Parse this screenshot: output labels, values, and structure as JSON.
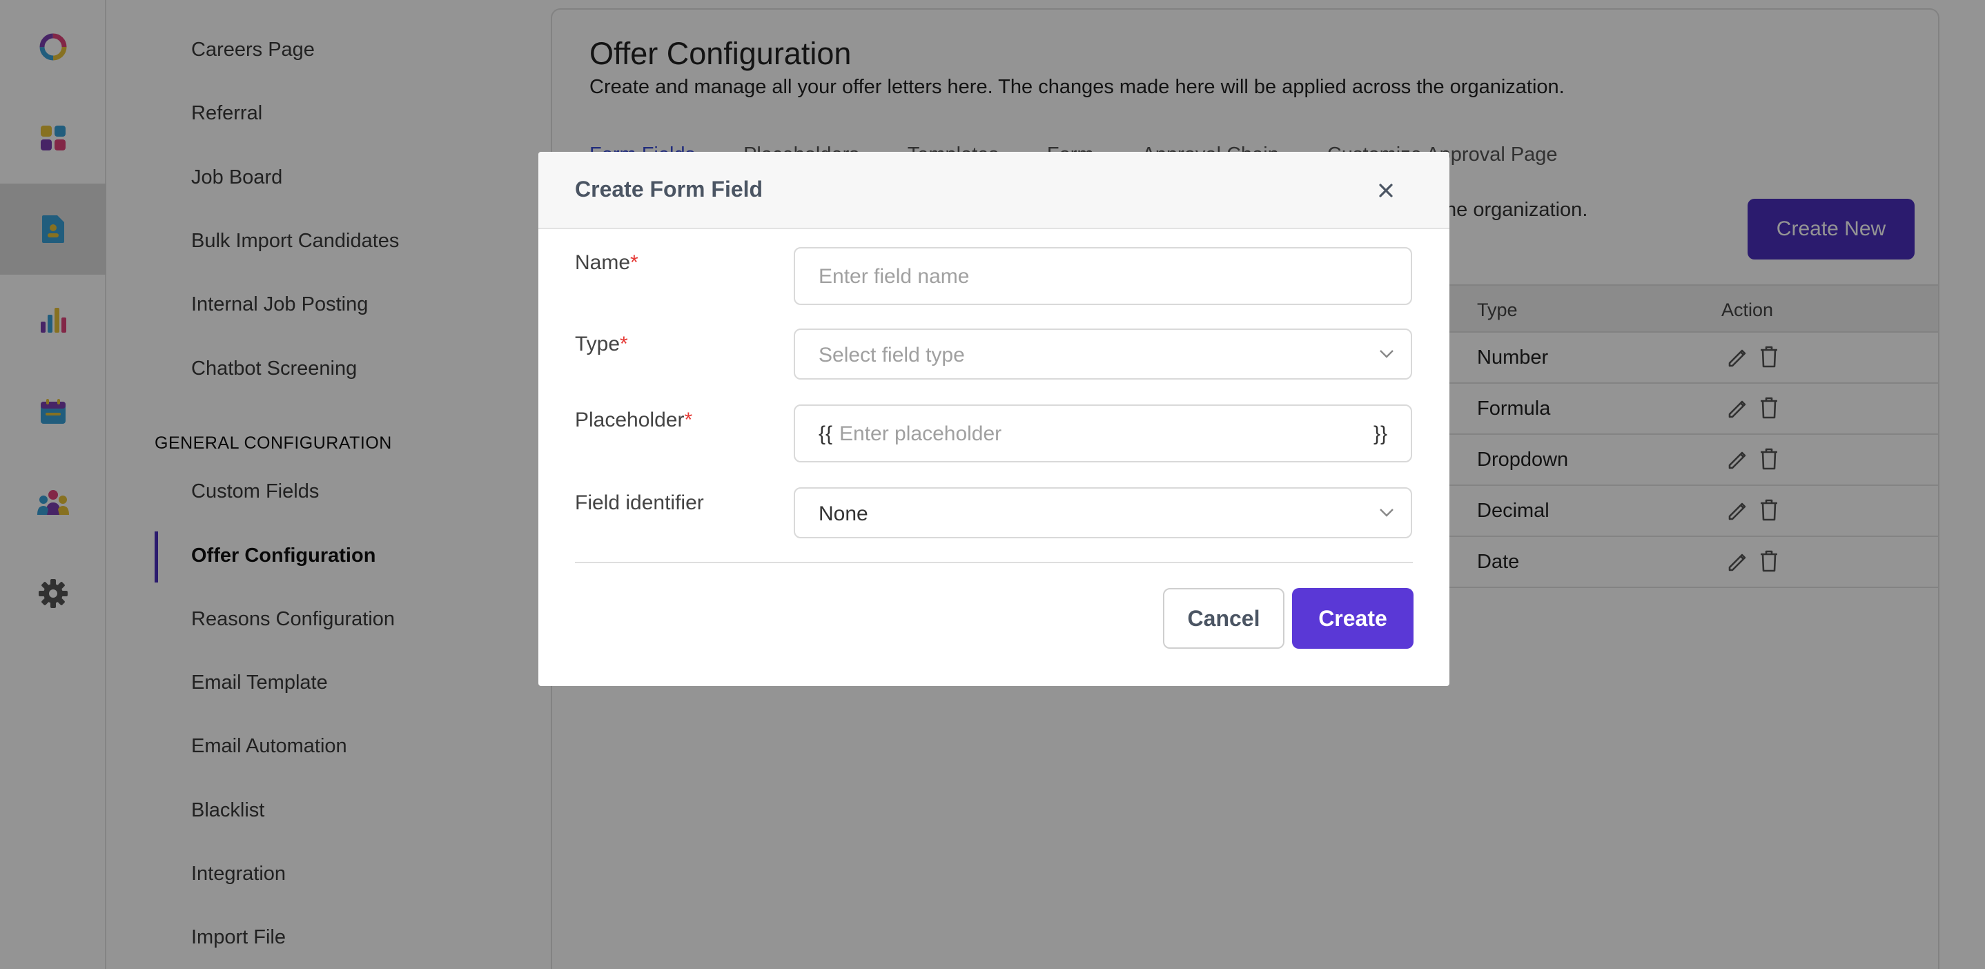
{
  "rail": {
    "icons": [
      "logo-ring-icon",
      "dashboard-grid-icon",
      "candidate-document-icon",
      "analytics-bar-icon",
      "calendar-icon",
      "team-icon",
      "gear-icon"
    ]
  },
  "sidebar": {
    "items_top": [
      "Careers Page",
      "Referral",
      "Job Board",
      "Bulk Import Candidates",
      "Internal Job Posting",
      "Chatbot Screening"
    ],
    "section_title": "GENERAL CONFIGURATION",
    "items_general": [
      "Custom Fields",
      "Offer Configuration",
      "Reasons Configuration",
      "Email Template",
      "Email Automation",
      "Blacklist",
      "Integration",
      "Import File"
    ],
    "active_item": "Offer Configuration"
  },
  "main": {
    "title": "Offer Configuration",
    "subtitle": "Create and manage all your offer letters here. The changes made here will be applied across the organization.",
    "tabs": [
      "Form Fields",
      "Placeholders",
      "Templates",
      "Form",
      "Approval Chain",
      "Customize Approval Page"
    ],
    "active_tab": "Form Fields",
    "tab_description_visible": "he organization.",
    "create_new_label": "Create New",
    "table": {
      "headers": [
        "Type",
        "Action"
      ],
      "rows": [
        {
          "type": "Number"
        },
        {
          "type": "Formula"
        },
        {
          "type": "Dropdown"
        },
        {
          "type": "Decimal"
        },
        {
          "type": "Date"
        }
      ]
    }
  },
  "modal": {
    "title": "Create Form Field",
    "fields": {
      "name": {
        "label": "Name",
        "required_mark": "*",
        "placeholder": "Enter field name"
      },
      "type": {
        "label": "Type",
        "required_mark": "*",
        "placeholder": "Select field type"
      },
      "placeholder": {
        "label": "Placeholder",
        "required_mark": "*",
        "prefix": "{{",
        "placeholder": "Enter placeholder",
        "suffix": "}}"
      },
      "field_identifier": {
        "label": "Field identifier",
        "value": "None"
      }
    },
    "cancel_label": "Cancel",
    "create_label": "Create"
  },
  "colors": {
    "accent": "#4a2fbd",
    "create_button": "#5a38d6",
    "active_tab": "#3c4fd6",
    "required": "#e53935"
  }
}
